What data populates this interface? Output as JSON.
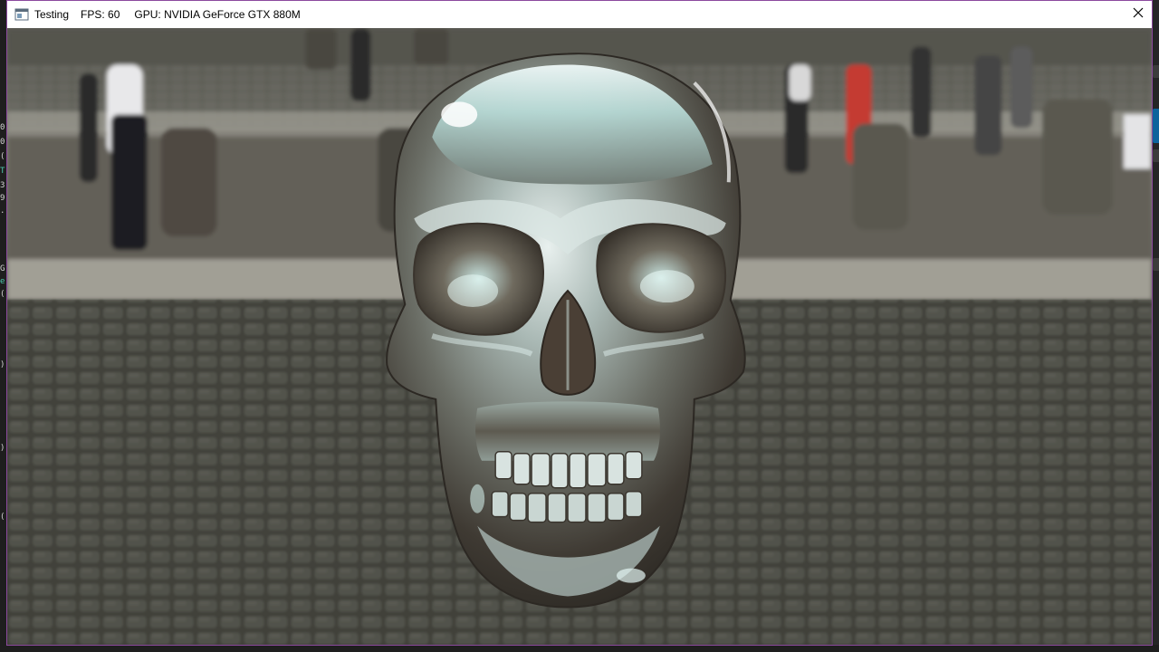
{
  "window": {
    "title": "Testing",
    "fps_text": "FPS: 60",
    "gpu_text": "GPU: NVIDIA GeForce GTX 880M"
  },
  "viewport": {
    "subject": "chrome-skull",
    "background": "cobblestone-plaza"
  },
  "colors": {
    "window_border": "#8c4a9e",
    "titlebar_bg": "#ffffff",
    "editor_bg": "#1e1e1e"
  },
  "icons": {
    "app": "window-icon",
    "close": "close-icon"
  }
}
